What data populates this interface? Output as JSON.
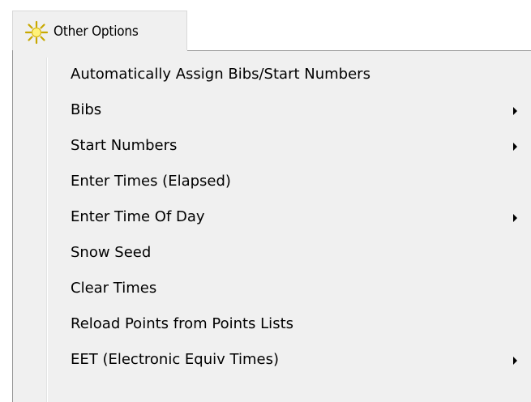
{
  "menubar": {
    "title": "Other Options",
    "icon": "sun-icon"
  },
  "menu": {
    "items": [
      {
        "label": "Automatically Assign Bibs/Start Numbers",
        "submenu": false
      },
      {
        "label": "Bibs",
        "submenu": true
      },
      {
        "label": "Start Numbers",
        "submenu": true
      },
      {
        "label": "Enter Times (Elapsed)",
        "submenu": false
      },
      {
        "label": "Enter Time Of Day",
        "submenu": true
      },
      {
        "label": "Snow Seed",
        "submenu": false
      },
      {
        "label": "Clear Times",
        "submenu": false
      },
      {
        "label": "Reload Points from Points Lists",
        "submenu": false
      },
      {
        "label": "EET (Electronic Equiv Times)",
        "submenu": true
      }
    ]
  }
}
